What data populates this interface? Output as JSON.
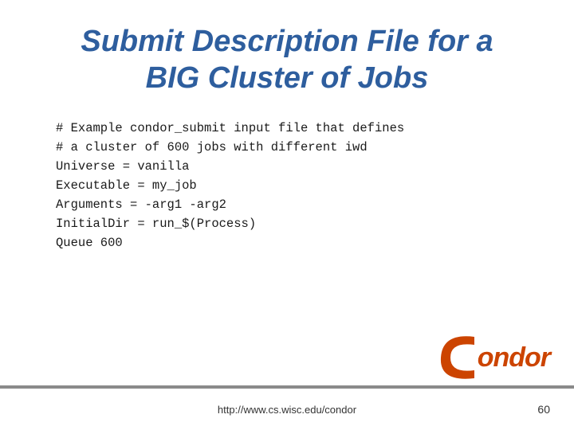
{
  "title": {
    "line1": "Submit Description File for a",
    "line2": "BIG Cluster of Jobs"
  },
  "code": {
    "lines": [
      "# Example condor_submit input file that defines",
      "# a cluster of 600 jobs with different iwd",
      "Universe   = vanilla",
      "Executable = my_job",
      "Arguments  = -arg1 -arg2",
      "InitialDir = run_$(Process)",
      "Queue 600"
    ]
  },
  "footer": {
    "url": "http://www.cs.wisc.edu/condor"
  },
  "page_number": "60",
  "condor_logo": {
    "c_text": "c",
    "ondor_text": "ondor"
  }
}
